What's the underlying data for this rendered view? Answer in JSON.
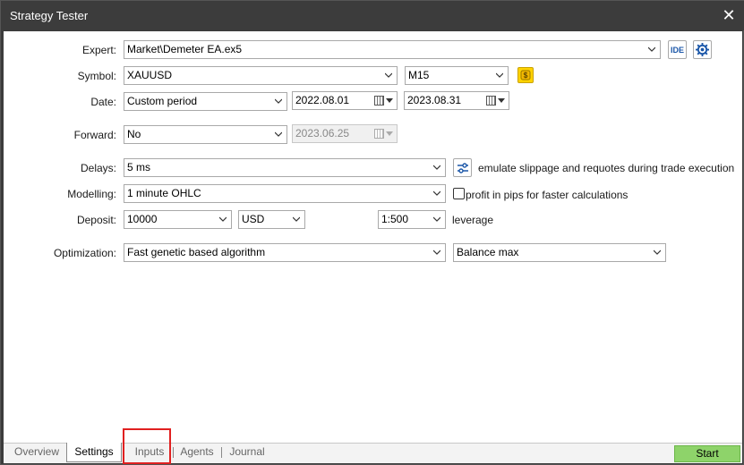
{
  "window": {
    "title": "Strategy Tester",
    "close_glyph": "✕"
  },
  "labels": {
    "expert": "Expert:",
    "symbol": "Symbol:",
    "date": "Date:",
    "forward": "Forward:",
    "delays": "Delays:",
    "modelling": "Modelling:",
    "deposit": "Deposit:",
    "optimization": "Optimization:"
  },
  "expert": {
    "value": "Market\\Demeter EA.ex5",
    "ide_label": "IDE",
    "settings_icon": "gear-icon"
  },
  "symbol": {
    "value": "XAUUSD",
    "timeframe": "M15",
    "spec_icon": "dollar-icon"
  },
  "date": {
    "period": "Custom period",
    "from": "2022.08.01",
    "to": "2023.08.31"
  },
  "forward": {
    "value": "No",
    "date": "2023.06.25"
  },
  "delays": {
    "value": "5 ms",
    "settings_icon": "sliders-icon",
    "emulate_text": "emulate slippage and requotes during trade execution"
  },
  "modelling": {
    "value": "1 minute OHLC",
    "pips_text": "profit in pips for faster calculations",
    "pips_checked": false
  },
  "deposit": {
    "amount": "10000",
    "currency": "USD",
    "leverage": "1:500",
    "leverage_label": "leverage"
  },
  "optimization": {
    "algorithm": "Fast genetic based algorithm",
    "criterion": "Balance max"
  },
  "tabs": [
    "Overview",
    "Settings",
    "Inputs",
    "Agents",
    "Journal"
  ],
  "active_tab": "Settings",
  "start_label": "Start",
  "colors": {
    "titlebar": "#3c3c3c",
    "start": "#8ed36a",
    "highlight": "#e02020"
  }
}
